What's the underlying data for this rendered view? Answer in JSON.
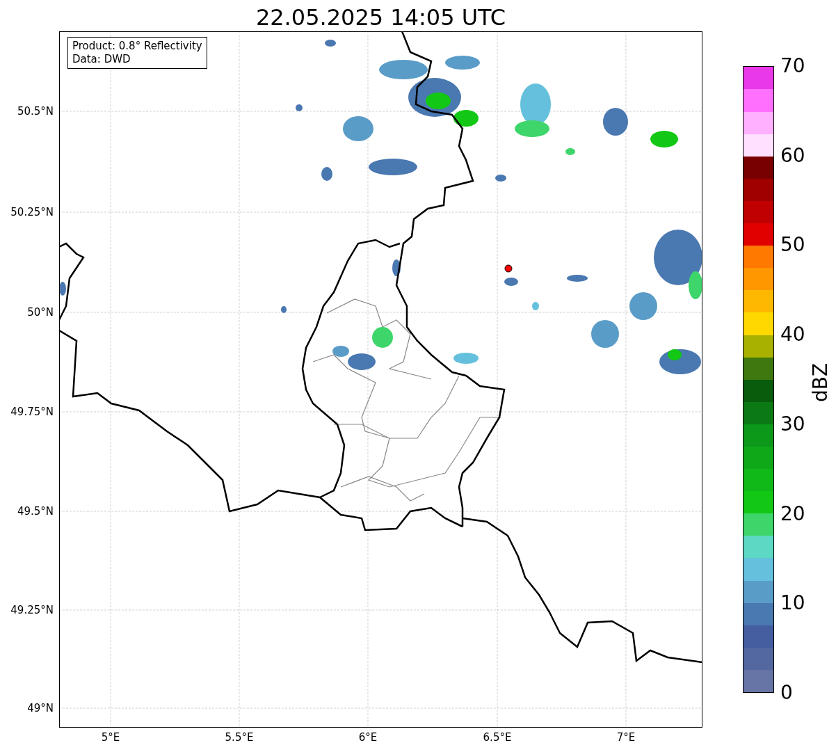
{
  "title": "22.05.2025 14:05 UTC",
  "info_box": {
    "lines": [
      "Product: 0.8° Reflectivity",
      "Data: DWD"
    ]
  },
  "map": {
    "y_ticks": [
      "50.5°N",
      "50.25°N",
      "50°N",
      "49.75°N",
      "49.5°N",
      "49.25°N",
      "49°N"
    ],
    "x_ticks": [
      "5°E",
      "5.5°E",
      "6°E",
      "6.5°E",
      "7°E"
    ]
  },
  "colorbar": {
    "label": "dBZ",
    "ticks": [
      "70",
      "60",
      "50",
      "40",
      "30",
      "20",
      "10",
      "0"
    ]
  }
}
